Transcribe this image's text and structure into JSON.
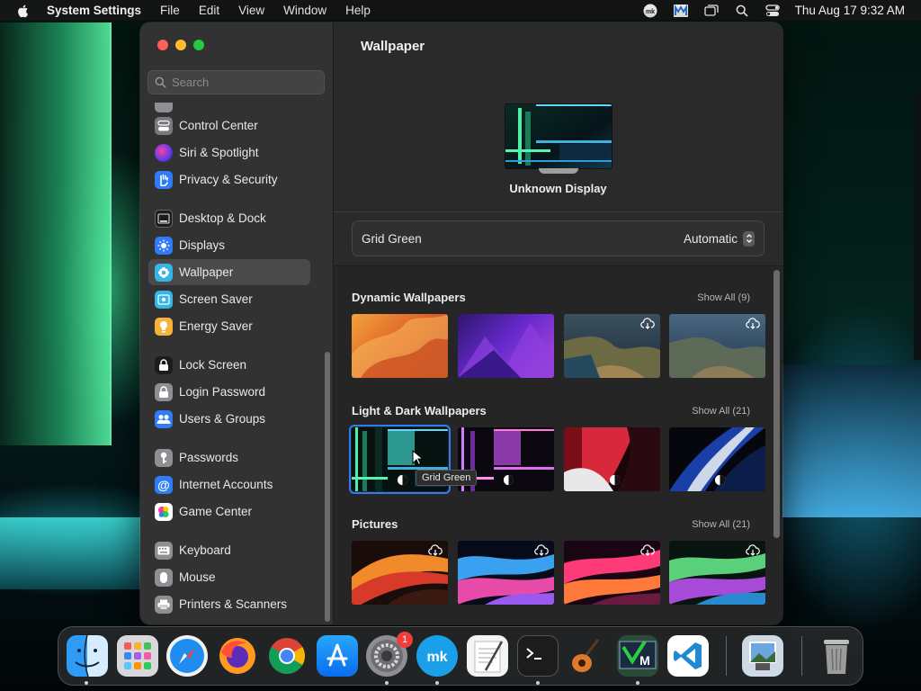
{
  "menubar": {
    "app_name": "System Settings",
    "menus": [
      "File",
      "Edit",
      "View",
      "Window",
      "Help"
    ],
    "clock": "Thu Aug 17  9:32 AM"
  },
  "sidebar": {
    "search_placeholder": "Search",
    "items": [
      {
        "label": "Control Center",
        "icon": "control-center-icon",
        "color": "#8e8e93"
      },
      {
        "label": "Siri & Spotlight",
        "icon": "siri-icon",
        "color": "#b0307a"
      },
      {
        "label": "Privacy & Security",
        "icon": "hand-icon",
        "color": "#2f7cf6"
      },
      {
        "label": "Desktop & Dock",
        "icon": "dock-icon",
        "color": "#3a3a3c"
      },
      {
        "label": "Displays",
        "icon": "sun-icon",
        "color": "#2f7cf6"
      },
      {
        "label": "Wallpaper",
        "icon": "wallpaper-icon",
        "color": "#35b5e8"
      },
      {
        "label": "Screen Saver",
        "icon": "screen-saver-icon",
        "color": "#35b5e8"
      },
      {
        "label": "Energy Saver",
        "icon": "battery-icon",
        "color": "#f5b33a"
      },
      {
        "label": "Lock Screen",
        "icon": "lock-icon",
        "color": "#1c1c1e"
      },
      {
        "label": "Login Password",
        "icon": "lock-icon",
        "color": "#8e8e93"
      },
      {
        "label": "Users & Groups",
        "icon": "users-icon",
        "color": "#2f7cf6"
      },
      {
        "label": "Passwords",
        "icon": "key-icon",
        "color": "#8e8e93"
      },
      {
        "label": "Internet Accounts",
        "icon": "at-icon",
        "color": "#2f7cf6"
      },
      {
        "label": "Game Center",
        "icon": "game-center-icon",
        "color": "#ffffff"
      },
      {
        "label": "Keyboard",
        "icon": "keyboard-icon",
        "color": "#8e8e93"
      },
      {
        "label": "Mouse",
        "icon": "mouse-icon",
        "color": "#8e8e93"
      },
      {
        "label": "Printers & Scanners",
        "icon": "printer-icon",
        "color": "#8e8e93"
      }
    ],
    "selected": "Wallpaper"
  },
  "main": {
    "title": "Wallpaper",
    "display_name": "Unknown Display",
    "current_wallpaper": "Grid Green",
    "appearance_value": "Automatic",
    "sections": [
      {
        "title": "Dynamic Wallpapers",
        "show_all": "Show All (9)"
      },
      {
        "title": "Light & Dark Wallpapers",
        "show_all": "Show All (21)"
      },
      {
        "title": "Pictures",
        "show_all": "Show All (21)"
      }
    ],
    "tooltip": "Grid Green"
  },
  "dock": {
    "apps": [
      "Finder",
      "Launchpad",
      "Safari",
      "Firefox",
      "Google Chrome",
      "App Store",
      "System Settings",
      "MK",
      "TextEdit",
      "Terminal",
      "GarageBand",
      "Vim",
      "Visual Studio Code",
      "Preview",
      "Trash"
    ],
    "settings_badge": "1"
  },
  "colors": {
    "accent": "#2d7cf6",
    "window_bg": "#2a2a2a",
    "sidebar_bg": "#323232"
  }
}
